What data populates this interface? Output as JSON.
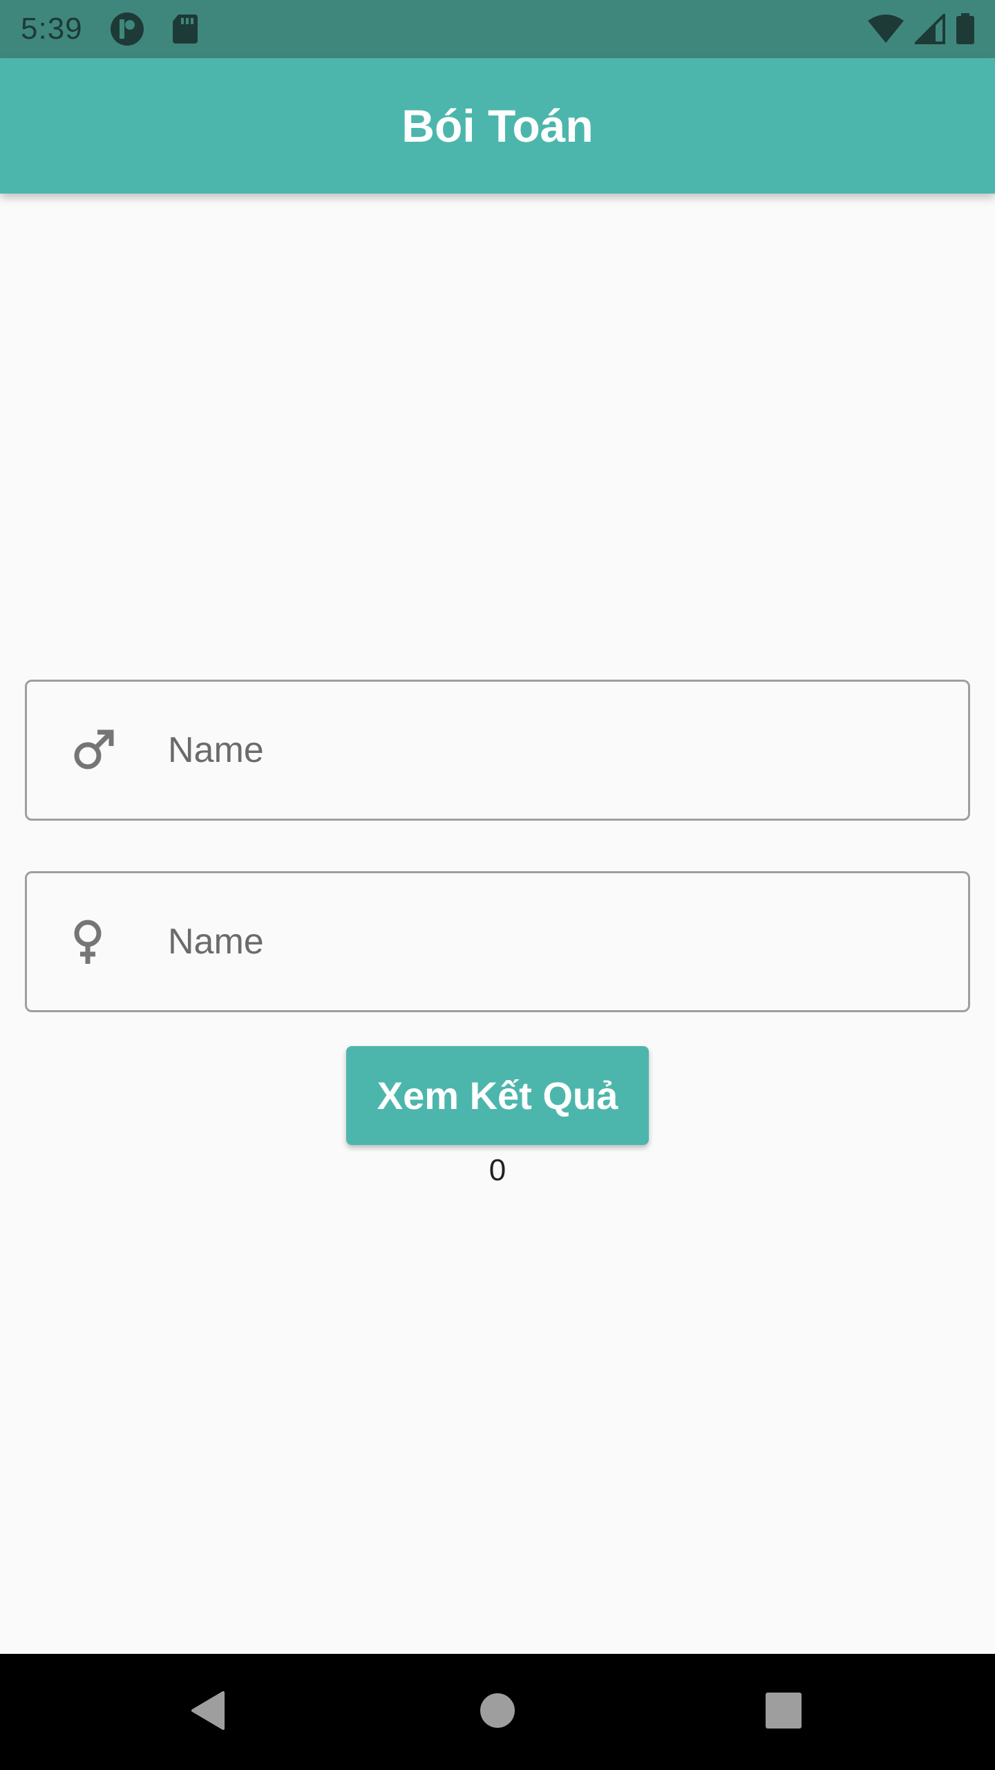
{
  "status_bar": {
    "time": "5:39",
    "icons": [
      "assistant-icon",
      "sd-card-icon",
      "wifi-icon",
      "cell-signal-icon",
      "battery-icon"
    ]
  },
  "app_bar": {
    "title": "Bói Toán",
    "color": "#4db6ac"
  },
  "form": {
    "male_name": {
      "icon": "male-symbol-icon",
      "placeholder": "Name",
      "value": ""
    },
    "female_name": {
      "icon": "female-symbol-icon",
      "placeholder": "Name",
      "value": ""
    },
    "submit_label": "Xem Kết Quả",
    "result": "0"
  },
  "nav_bar": {
    "icons": [
      "back-icon",
      "home-icon",
      "recent-apps-icon"
    ]
  },
  "colors": {
    "primary": "#4db6ac",
    "status_bar": "#3f877d",
    "background": "#fafafa",
    "border": "#9e9e9e"
  }
}
